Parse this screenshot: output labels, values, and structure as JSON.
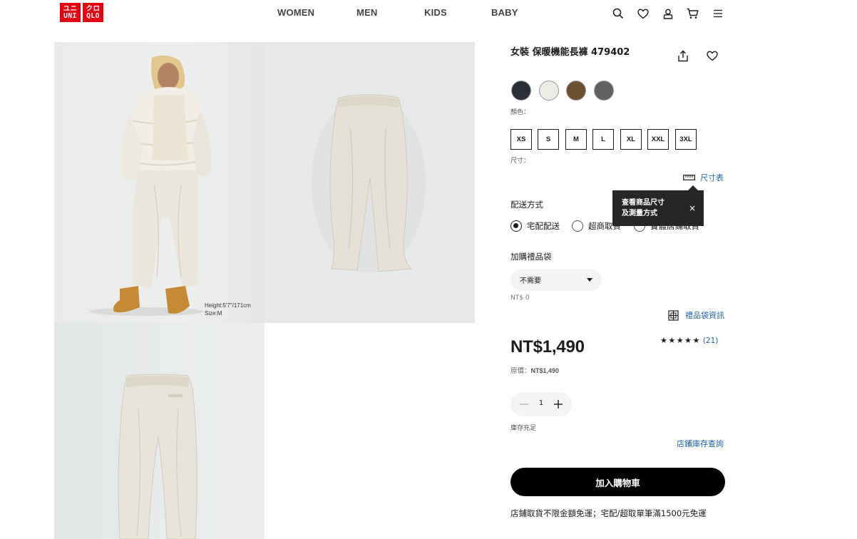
{
  "header": {
    "logo_top": "ユニ クロ",
    "logo_bottom": "UNI QLO",
    "logo_text": [
      "ユニ",
      "クロ",
      "UNI",
      "QLO"
    ],
    "nav": [
      "WOMEN",
      "MEN",
      "KIDS",
      "BABY"
    ],
    "icons": [
      "search-icon",
      "heart-icon",
      "account-icon",
      "cart-icon",
      "menu-icon"
    ]
  },
  "gallery": {
    "model_caption_line1": "Height:5'7\"/171cm",
    "model_caption_line2": "Size:M"
  },
  "product": {
    "title": "女裝 保暖機能長褲 479402",
    "colors": [
      "#2b3036",
      "#ececE6",
      "#6e5133",
      "#606160"
    ],
    "color_label": "顏色：",
    "sizes": [
      "XS",
      "S",
      "M",
      "L",
      "XL",
      "XXL",
      "3XL"
    ],
    "size_label": "尺寸：",
    "size_chart_label": "尺寸表",
    "tooltip_line1": "查看商品尺寸",
    "tooltip_line2": "及測量方式",
    "tooltip_close": "×",
    "delivery_label": "配送方式",
    "delivery_options": [
      "宅配配送",
      "超商取貨",
      "實體店鋪取貨"
    ],
    "gift_label": "加購禮品袋",
    "gift_select_value": "不需要",
    "gift_price": "NT$ 0",
    "gift_info_label": "禮品袋資訊",
    "price": "NT$1,490",
    "original_price_label": "原價：",
    "original_price_value": "NT$1,490",
    "rating_stars": "★★★★★",
    "rating_count": "(21)",
    "rating_value": 5,
    "quantity": "1",
    "stock_status": "庫存充足",
    "store_stock_link": "店鋪庫存查詢",
    "add_to_cart": "加入購物車",
    "shipping_note": "店鋪取貨不限金額免運；宅配/超取單筆滿1500元免運"
  }
}
